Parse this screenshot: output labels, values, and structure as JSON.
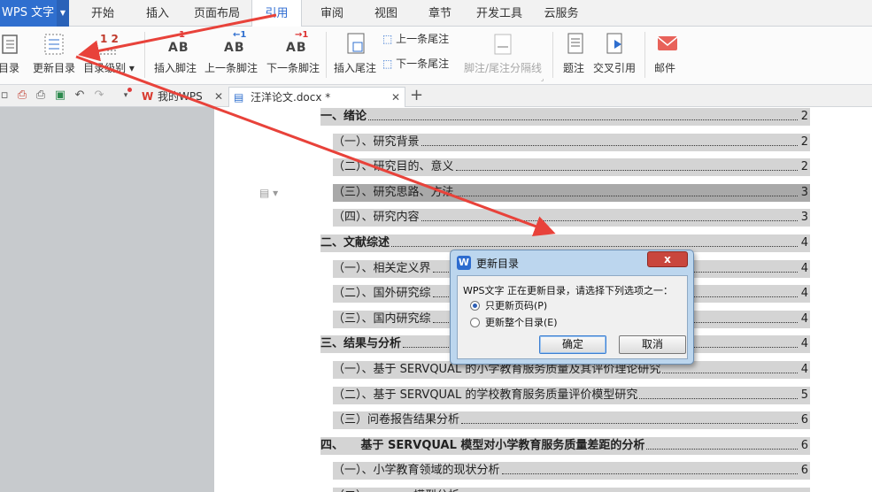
{
  "menu": {
    "app_name": "WPS 文字",
    "tabs": [
      "开始",
      "插入",
      "页面布局",
      "引用",
      "审阅",
      "视图",
      "章节",
      "开发工具",
      "云服务"
    ],
    "active_tab": "引用"
  },
  "ribbon": {
    "toc_label": "目录",
    "update_toc_label": "更新目录",
    "toc_level_label": "目录级别",
    "insert_footnote_label": "插入脚注",
    "prev_footnote_label": "上一条脚注",
    "next_footnote_label": "下一条脚注",
    "insert_endnote_label": "插入尾注",
    "prev_endnote_label": "上一条尾注",
    "next_endnote_label": "下一条尾注",
    "separator_label": "脚注/尾注分隔线",
    "caption_label": "题注",
    "crossref_label": "交叉引用",
    "mail_label": "邮件",
    "ab_text": "AB",
    "level_icon_text": "1 2"
  },
  "tabbar": {
    "tabs": [
      "我的WPS",
      "汪洋论文.docx *"
    ],
    "add_symbol": "+"
  },
  "toc": [
    {
      "text": "一、绪论",
      "page": "2",
      "level": 1
    },
    {
      "text": "（一）、研究背景",
      "page": "2",
      "level": 2
    },
    {
      "text": "（二）、研究目的、意义",
      "page": "2",
      "level": 2
    },
    {
      "text": "（三）、研究思路、方法",
      "page": "3",
      "level": 2
    },
    {
      "text": "（四）、研究内容",
      "page": "3",
      "level": 2
    },
    {
      "text": "二、文献综述",
      "page": "4",
      "level": 1
    },
    {
      "text": "（一）、相关定义界",
      "page": "4",
      "level": 2
    },
    {
      "text": "（二）、国外研究综",
      "page": "4",
      "level": 2
    },
    {
      "text": "（三）、国内研究综",
      "page": "4",
      "level": 2
    },
    {
      "text": "三、结果与分析",
      "page": "4",
      "level": 1
    },
    {
      "text": "（一）、基于 SERVQUAL 的小学教育服务质量及其评价理论研究",
      "page": "4",
      "level": 2
    },
    {
      "text": "（二）、基于 SERVQUAL 的学校教育服务质量评价模型研究",
      "page": "5",
      "level": 2
    },
    {
      "text": "（三）问卷报告结果分析",
      "page": "6",
      "level": 2
    },
    {
      "text": "四、　　基于 SERVQUAL 模型对小学教育服务质量差距的分析",
      "page": "6",
      "level": 1
    },
    {
      "text": "（一）、小学教育领域的现状分析",
      "page": "6",
      "level": 2
    },
    {
      "text": "（二）、　　　　模型分析",
      "page": "",
      "level": 2
    }
  ],
  "dialog": {
    "title": "更新目录",
    "message": "WPS文字 正在更新目录，请选择下列选项之一：",
    "options": [
      "只更新页码(P)",
      "更新整个目录(E)"
    ],
    "selected_option": 0,
    "ok_label": "确定",
    "cancel_label": "取消",
    "close_symbol": "x",
    "logo_letter": "W"
  },
  "colors": {
    "accent": "#2b6ad1",
    "arrow": "#e8423a",
    "toc_highlight": "#d4d4d4"
  }
}
